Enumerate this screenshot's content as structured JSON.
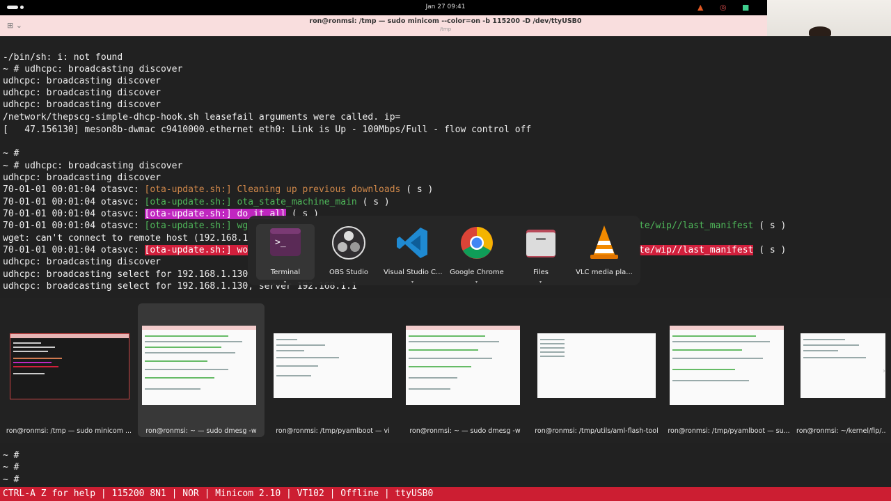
{
  "topbar": {
    "clock": "Jan 27  09:41"
  },
  "window": {
    "title": "ron@ronmsi: /tmp — sudo minicom --color=on -b 115200 -D /dev/ttyUSB0",
    "subtitle": "/tmp"
  },
  "terminal": {
    "lines": [
      "-/bin/sh: i: not found",
      "~ # udhcpc: broadcasting discover",
      "udhcpc: broadcasting discover",
      "udhcpc: broadcasting discover",
      "udhcpc: broadcasting discover",
      "/network/thepscg-simple-dhcp-hook.sh leasefail arguments were called. ip=",
      "[   47.156130] meson8b-dwmac c9410000.ethernet eth0: Link is Up - 100Mbps/Full - flow control off",
      "",
      "~ #",
      "~ # udhcpc: broadcasting discover",
      "udhcpc: broadcasting discover"
    ],
    "ota_prefix": "70-01-01 00:01:04 otasvc: ",
    "ota_tag": "[ota-update.sh:]",
    "ota1_msg": " Cleaning up previous downloads",
    "ota_suffix": " ( s )",
    "ota2_msg": " ota_state_machine_main",
    "ota3_msg": " do_it_all",
    "ota4_msg": " wg",
    "ota4_tail": "te/wip//last_manifest",
    "wget_line": "wget: can't connect to remote host (192.168.1",
    "ota6_msg": " wo",
    "ota6_tail": "te/wip//last_manifest",
    "after": [
      "udhcpc: broadcasting discover",
      "udhcpc: broadcasting select for 192.168.1.130",
      "udhcpc: broadcasting select for 192.168.1.130, server 192.168.1.1"
    ],
    "bottom": [
      "~ #",
      "~ #",
      "~ #"
    ]
  },
  "statusbar": {
    "text": "CTRL-A Z for help | 115200 8N1 | NOR | Minicom 2.10 | VT102 | Offline | ttyUSB0"
  },
  "dock": {
    "apps": [
      {
        "label": "Terminal",
        "icon": "terminal-icon"
      },
      {
        "label": "OBS Studio",
        "icon": "obs-icon"
      },
      {
        "label": "Visual Studio C...",
        "icon": "vscode-icon"
      },
      {
        "label": "Google Chrome",
        "icon": "chrome-icon"
      },
      {
        "label": "Files",
        "icon": "files-icon"
      },
      {
        "label": "VLC media pla...",
        "icon": "vlc-icon"
      }
    ],
    "terminal_glyph": ">_"
  },
  "switcher": {
    "windows": [
      {
        "label": "ron@ronmsi: /tmp — sudo minicom ..."
      },
      {
        "label": "ron@ronmsi: ~ — sudo dmesg -w"
      },
      {
        "label": "ron@ronmsi: /tmp/pyamlboot — vi"
      },
      {
        "label": "ron@ronmsi: ~ — sudo dmesg -w"
      },
      {
        "label": "ron@ronmsi: /tmp/utils/aml-flash-tool"
      },
      {
        "label": "ron@ronmsi: /tmp/pyamlboot — su..."
      },
      {
        "label": "ron@ronmsi: ~/kernel/fip/..."
      }
    ]
  },
  "colors": {
    "accent_red": "#cc1e32",
    "highlight_magenta": "#c026c0",
    "titlebar_pink": "#f9dede"
  }
}
